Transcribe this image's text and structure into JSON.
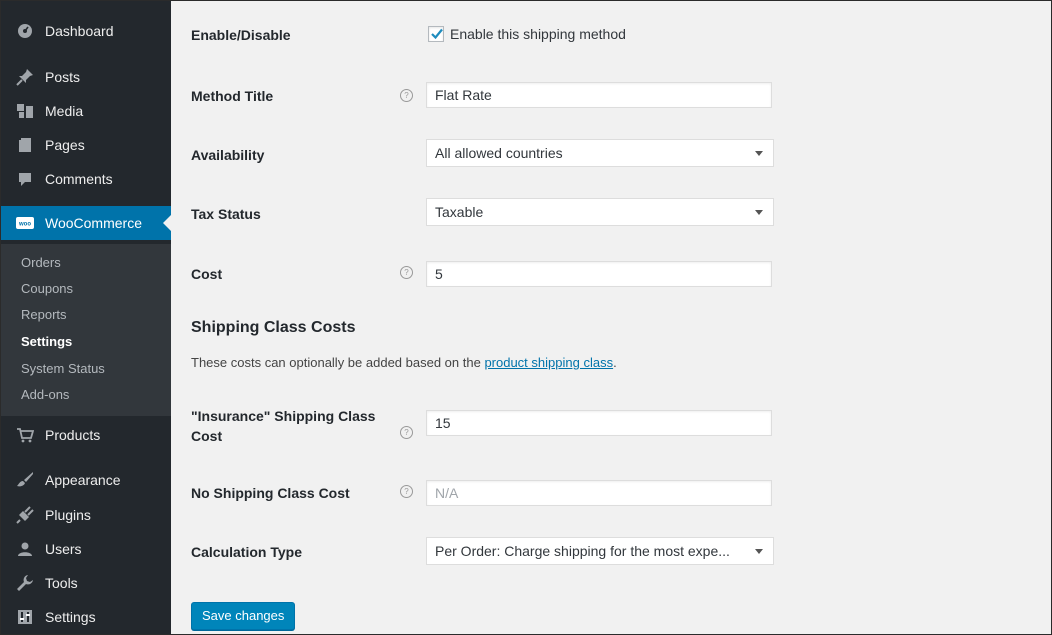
{
  "sidebar": {
    "top_items": [
      {
        "label": "Dashboard",
        "icon": "dashboard-icon"
      },
      {
        "label": "Posts",
        "icon": "pushpin-icon"
      },
      {
        "label": "Media",
        "icon": "media-icon"
      },
      {
        "label": "Pages",
        "icon": "pages-icon"
      },
      {
        "label": "Comments",
        "icon": "comment-icon"
      }
    ],
    "woocommerce": {
      "label": "WooCommerce",
      "icon_text": "woo"
    },
    "submenu": [
      "Orders",
      "Coupons",
      "Reports",
      "Settings",
      "System Status",
      "Add-ons"
    ],
    "current_submenu": "Settings",
    "bottom_items": [
      {
        "label": "Products",
        "icon": "cart-icon"
      },
      {
        "label": "Appearance",
        "icon": "brush-icon"
      },
      {
        "label": "Plugins",
        "icon": "plugin-icon"
      },
      {
        "label": "Users",
        "icon": "user-icon"
      },
      {
        "label": "Tools",
        "icon": "wrench-icon"
      },
      {
        "label": "Settings",
        "icon": "settings-icon"
      }
    ]
  },
  "form": {
    "enable": {
      "label": "Enable/Disable",
      "checkbox_label": "Enable this shipping method",
      "checked": true
    },
    "method_title": {
      "label": "Method Title",
      "value": "Flat Rate"
    },
    "availability": {
      "label": "Availability",
      "value": "All allowed countries"
    },
    "tax_status": {
      "label": "Tax Status",
      "value": "Taxable"
    },
    "cost": {
      "label": "Cost",
      "value": "5"
    },
    "section_title": "Shipping Class Costs",
    "section_desc": "These costs can optionally be added based on the ",
    "section_link": "product shipping class",
    "section_desc_end": ".",
    "insurance": {
      "label_line1": "\"Insurance\" Shipping Class",
      "label_line2": "Cost",
      "value": "15"
    },
    "no_class": {
      "label": "No Shipping Class Cost",
      "placeholder": "N/A"
    },
    "calc_type": {
      "label": "Calculation Type",
      "value": "Per Order: Charge shipping for the most expe..."
    },
    "save_label": "Save changes"
  },
  "colors": {
    "sidebar_bg": "#23282d",
    "active_bg": "#0073aa",
    "button_bg": "#0085ba",
    "link": "#0073aa"
  }
}
